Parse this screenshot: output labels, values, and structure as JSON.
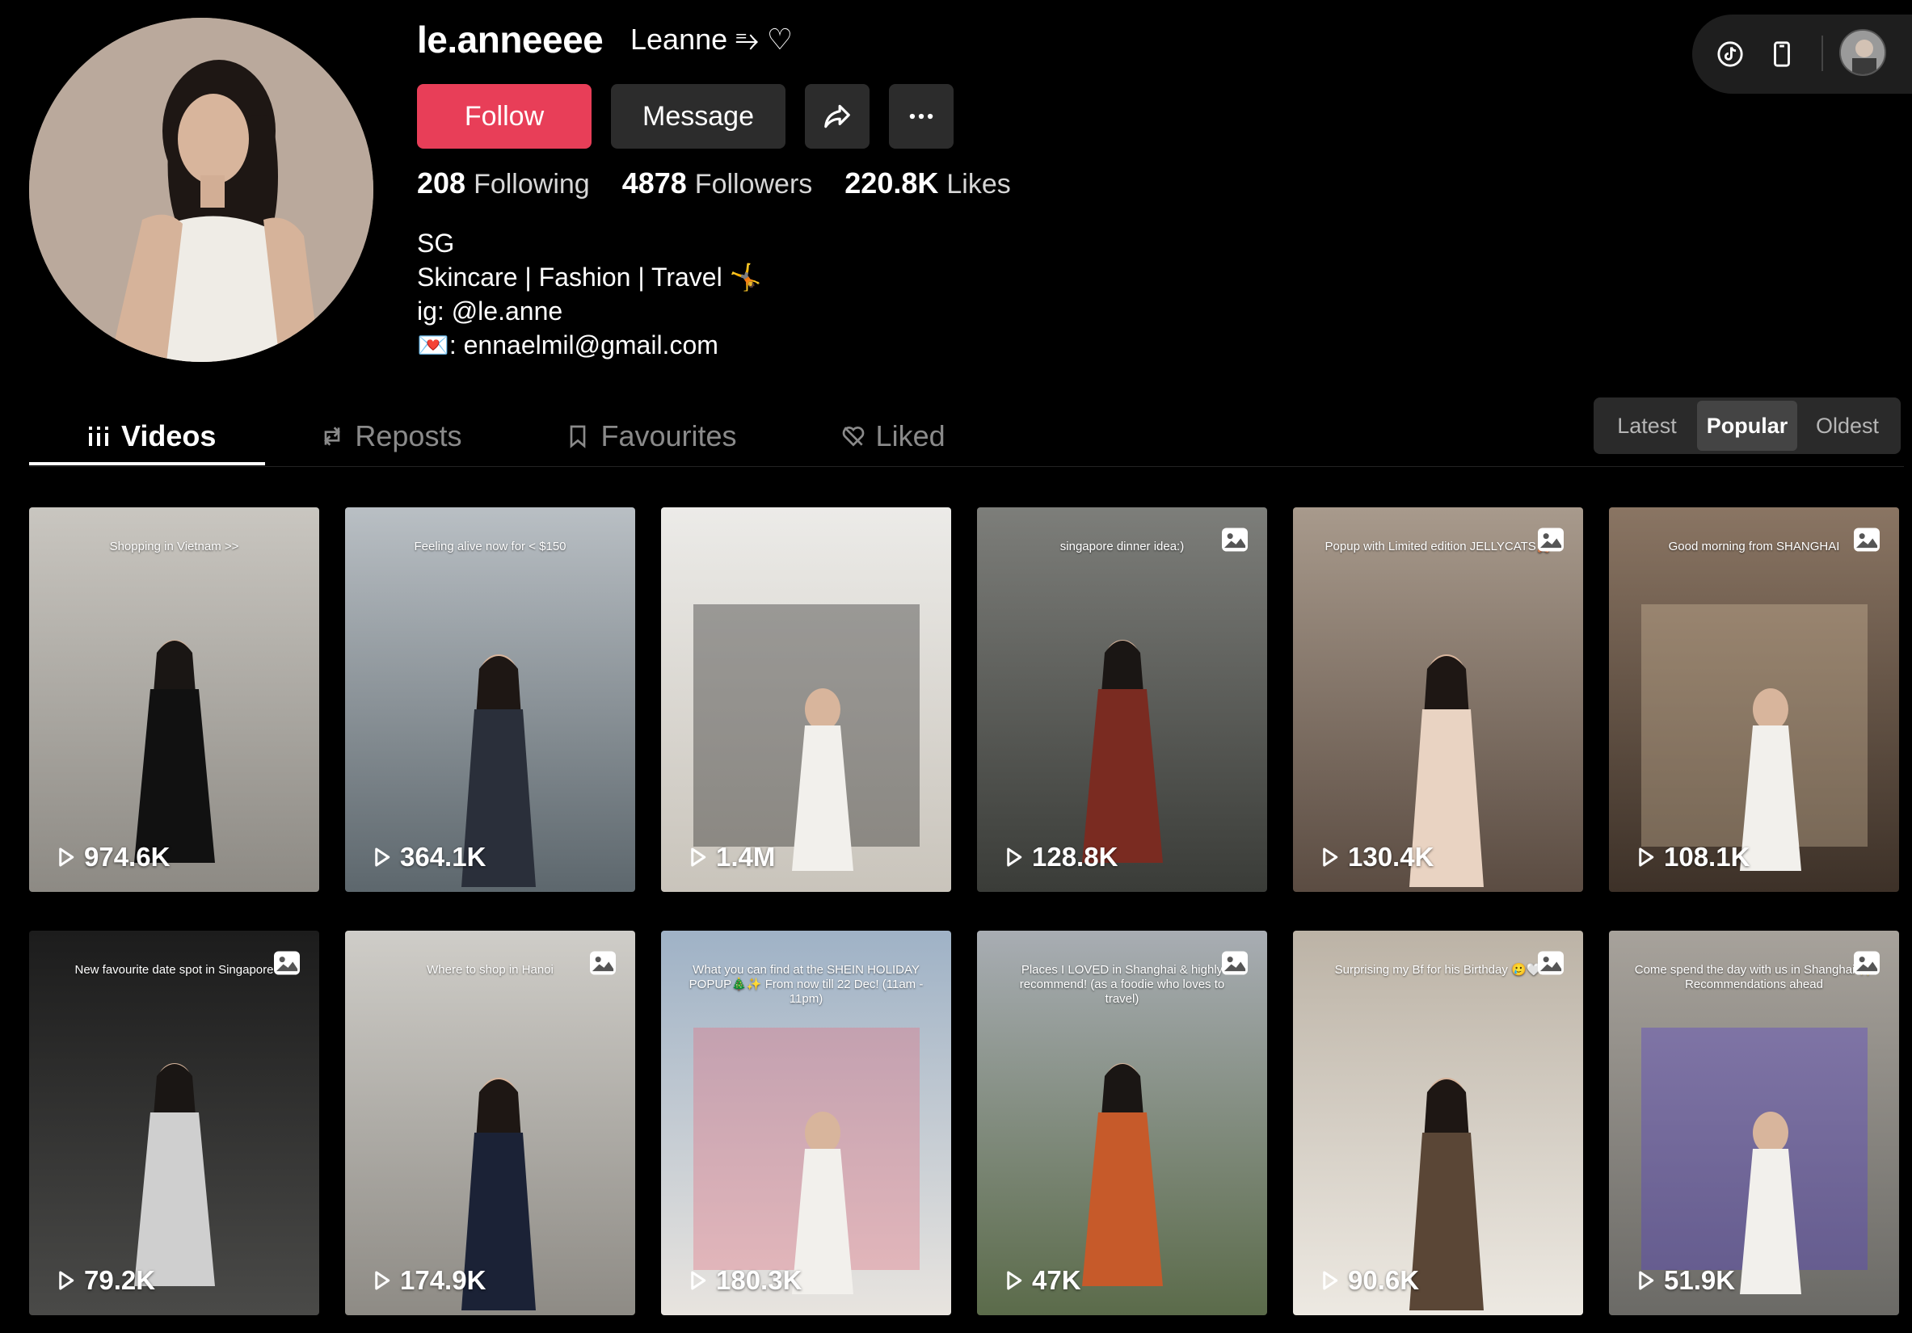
{
  "profile": {
    "username": "le.anneeee",
    "display_name": "Leanne ⥱ ♡",
    "follow_label": "Follow",
    "message_label": "Message",
    "stats": [
      {
        "value": "208",
        "label": "Following"
      },
      {
        "value": "4878",
        "label": "Followers"
      },
      {
        "value": "220.8K",
        "label": "Likes"
      }
    ],
    "bio": [
      "SG",
      "Skincare | Fashion | Travel 🤸",
      "ig: @le.anne",
      "💌: ennaelmil@gmail.com"
    ]
  },
  "tabs": [
    {
      "label": "Videos",
      "icon": "grid-bars-icon",
      "active": true
    },
    {
      "label": "Reposts",
      "icon": "repost-icon",
      "active": false
    },
    {
      "label": "Favourites",
      "icon": "bookmark-icon",
      "active": false
    },
    {
      "label": "Liked",
      "icon": "heart-off-icon",
      "active": false
    }
  ],
  "sort": [
    "Latest",
    "Popular",
    "Oldest"
  ],
  "sort_active": "Popular",
  "videos": [
    {
      "views": "974.6K",
      "text": "Shopping in Vietnam >>",
      "photo": false,
      "bg": [
        "#c9c6c0",
        "#8d8a84"
      ],
      "accent": "#111"
    },
    {
      "views": "364.1K",
      "text": "Feeling alive now for < $150",
      "photo": false,
      "bg": [
        "#b9bfc4",
        "#5d676d"
      ],
      "accent": "#2a2f3a"
    },
    {
      "views": "1.4M",
      "text": "",
      "photo": false,
      "bg": [
        "#ecebe8",
        "#c9c4bb"
      ],
      "accent": "#111"
    },
    {
      "views": "128.8K",
      "text": "singapore dinner idea:)",
      "photo": true,
      "bg": [
        "#7d7e7a",
        "#3a3c38"
      ],
      "accent": "#7a2b21"
    },
    {
      "views": "130.4K",
      "text": "Popup with Limited edition JELLYCATS🧸",
      "photo": true,
      "bg": [
        "#a89a8c",
        "#5b4c42"
      ],
      "accent": "#e9d3c2"
    },
    {
      "views": "108.1K",
      "text": "Good morning from SHANGHAI",
      "photo": true,
      "bg": [
        "#8a7563",
        "#3d3128"
      ],
      "accent": "#d9c2a2"
    },
    {
      "views": "79.2K",
      "text": "New favourite date spot in Singapore",
      "photo": true,
      "bg": [
        "#1c1c1c",
        "#4a4a48"
      ],
      "accent": "#cfcfcf"
    },
    {
      "views": "174.9K",
      "text": "Where to shop in Hanoi",
      "photo": true,
      "bg": [
        "#cfcdc8",
        "#8e8b85"
      ],
      "accent": "#1b2236"
    },
    {
      "views": "180.3K",
      "text": "What you can find at the SHEIN HOLIDAY POPUP🎄✨ From now till 22 Dec! (11am - 11pm)",
      "photo": false,
      "bg": [
        "#9fb2c6",
        "#e8e4df"
      ],
      "accent": "#e66a7a"
    },
    {
      "views": "47K",
      "text": "Places I LOVED in Shanghai & highly recommend! (as a foodie who loves to travel)",
      "photo": true,
      "bg": [
        "#a8adb3",
        "#5b6b4a"
      ],
      "accent": "#c65a2a"
    },
    {
      "views": "90.6K",
      "text": "Surprising my Bf for his Birthday 🥲🤍",
      "photo": true,
      "bg": [
        "#bcb3a6",
        "#ede9e2"
      ],
      "accent": "#5a4636"
    },
    {
      "views": "51.9K",
      "text": "Come spend the day with us in Shanghai ✨ Recommendations ahead",
      "photo": true,
      "bg": [
        "#a7a29b",
        "#6b6a66"
      ],
      "accent": "#4f3ad0"
    }
  ],
  "colors": {
    "follow": "#e83e58",
    "background": "#000000",
    "button": "#2c2c2c"
  }
}
